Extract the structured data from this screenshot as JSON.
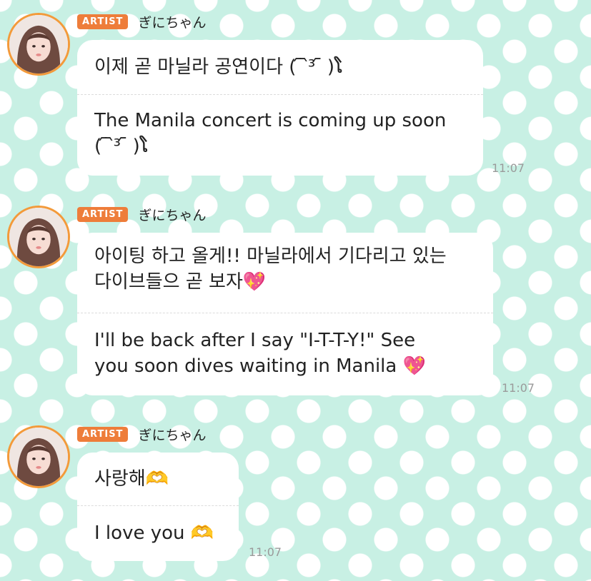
{
  "messages": [
    {
      "badge": "ARTIST",
      "name": "ぎにちゃん",
      "original": "이제 곧 마닐라 공연이다 ( ᷇ ᷆³ ᷇ )ໂ",
      "translation_line1": "The Manila concert is coming up soon",
      "translation_line2": "( ᷇ ᷆³ ᷇ )ໂ",
      "time": "11:07"
    },
    {
      "badge": "ARTIST",
      "name": "ぎにちゃん",
      "original_line1": "아이팅 하고 올게!! 마닐라에서 기다리고 있는",
      "original_line2": "다이브들으 곧 보자💖",
      "translation_line1": "I'll be back after I say \"I-T-T-Y!\" See",
      "translation_line2": "you soon dives waiting in Manila 💖",
      "time": "11:07"
    },
    {
      "badge": "ARTIST",
      "name": "ぎにちゃん",
      "original": "사랑해🫶",
      "translation": "I love you 🫶",
      "time": "11:07"
    }
  ],
  "icons": {
    "avatar": "profile-photo",
    "heart": "sparkling-heart-emoji",
    "hands": "heart-hands-emoji"
  },
  "colors": {
    "badge": "#ee7d3a",
    "avatar_ring": "#f39a3a",
    "background": "#c8f0e4",
    "bubble": "#ffffff"
  }
}
